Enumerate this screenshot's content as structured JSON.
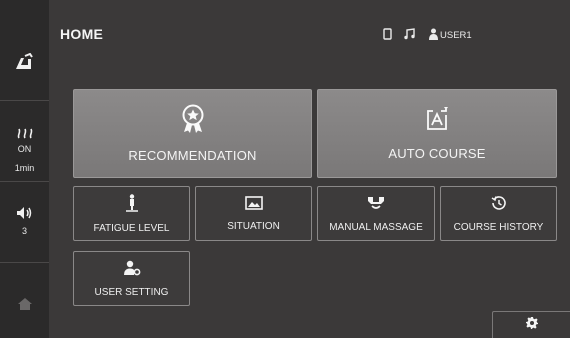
{
  "header": {
    "title": "HOME",
    "user": "USER1"
  },
  "sidebar": {
    "heater_state": "ON",
    "heater_time": "1min",
    "volume": "3"
  },
  "tiles": {
    "recommendation": "RECOMMENDATION",
    "auto_course": "AUTO COURSE",
    "fatigue_level": "FATIGUE LEVEL",
    "situation": "SITUATION",
    "manual_massage": "MANUAL MASSAGE",
    "course_history": "COURSE HISTORY",
    "user_setting": "USER SETTING"
  },
  "icons": {
    "sidebar": [
      "massage-chair-icon",
      "heat-icon",
      "volume-icon",
      "home-icon"
    ],
    "status": [
      "phone-icon",
      "music-icon",
      "user-icon"
    ],
    "settings": "gear-icon"
  },
  "colors": {
    "background": "#3b3939",
    "sidebar": "#2b2a2a",
    "tile_big": "#858383"
  }
}
